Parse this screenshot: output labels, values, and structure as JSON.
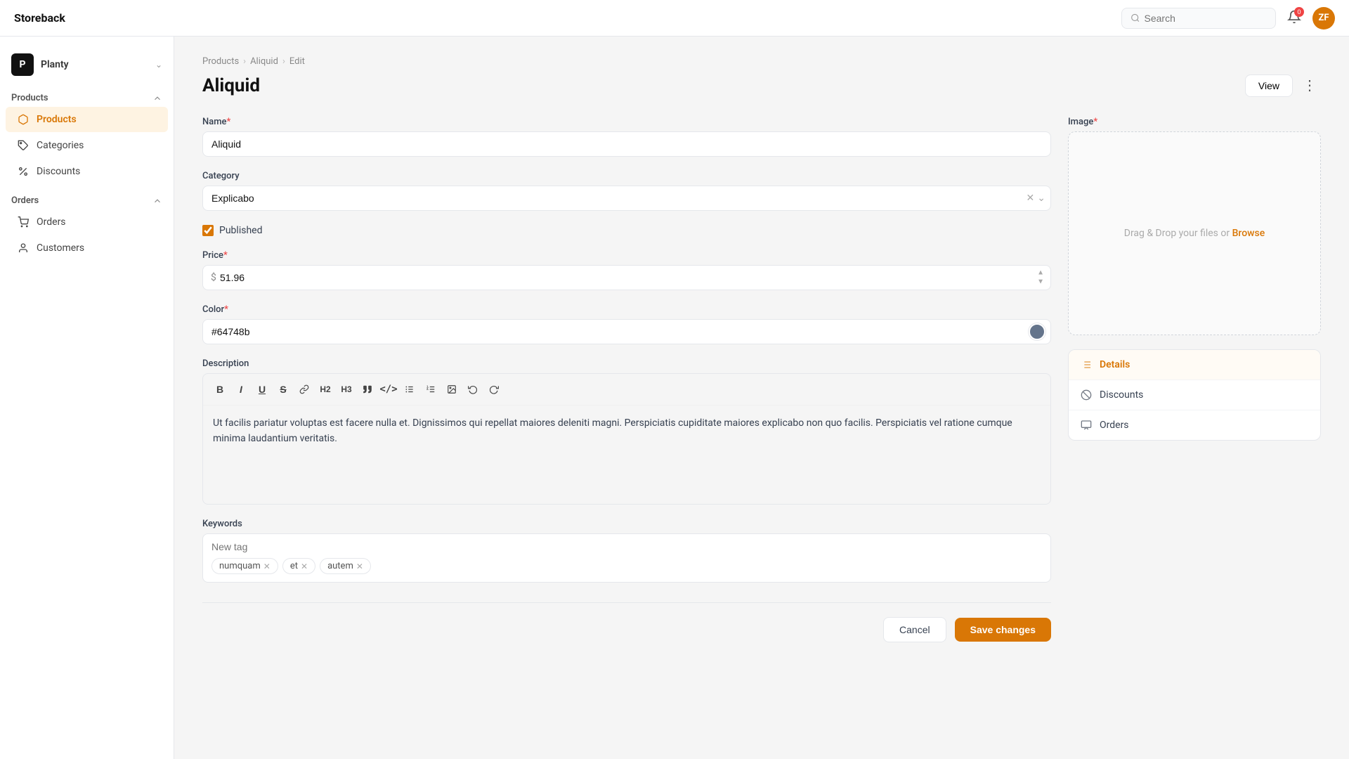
{
  "app": {
    "logo": "Storeback"
  },
  "topnav": {
    "search_placeholder": "Search",
    "notif_count": "0",
    "avatar_initials": "ZF"
  },
  "sidebar": {
    "store_initial": "P",
    "store_name": "Planty",
    "sections": [
      {
        "id": "products",
        "label": "Products",
        "items": [
          {
            "id": "products",
            "label": "Products",
            "active": true,
            "icon": "box"
          },
          {
            "id": "categories",
            "label": "Categories",
            "active": false,
            "icon": "tag"
          },
          {
            "id": "discounts",
            "label": "Discounts",
            "active": false,
            "icon": "percent"
          }
        ]
      },
      {
        "id": "orders",
        "label": "Orders",
        "items": [
          {
            "id": "orders",
            "label": "Orders",
            "active": false,
            "icon": "cart"
          },
          {
            "id": "customers",
            "label": "Customers",
            "active": false,
            "icon": "person"
          }
        ]
      }
    ]
  },
  "breadcrumb": {
    "items": [
      "Products",
      "Aliquid",
      "Edit"
    ]
  },
  "page": {
    "title": "Aliquid",
    "view_btn": "View"
  },
  "form": {
    "name_label": "Name",
    "name_value": "Aliquid",
    "category_label": "Category",
    "category_value": "Explicabo",
    "published_label": "Published",
    "price_label": "Price",
    "price_currency": "$",
    "price_value": "51.96",
    "color_label": "Color",
    "color_value": "#64748b",
    "description_label": "Description",
    "description_text": "Ut facilis pariatur voluptas est facere nulla et. Dignissimos qui repellat maiores deleniti magni. Perspiciatis cupiditate maiores explicabo non quo facilis. Perspiciatis vel ratione cumque minima laudantium veritatis.",
    "image_label": "Image",
    "image_upload_text": "Drag & Drop your files or",
    "image_browse": "Browse",
    "keywords_label": "Keywords",
    "keywords_placeholder": "New tag",
    "tags": [
      "numquam",
      "et",
      "autem"
    ],
    "cancel_btn": "Cancel",
    "save_btn": "Save changes"
  },
  "right_panel": {
    "items": [
      {
        "id": "details",
        "label": "Details",
        "active": true,
        "icon": "list"
      },
      {
        "id": "discounts",
        "label": "Discounts",
        "active": false,
        "icon": "circle-off"
      },
      {
        "id": "orders",
        "label": "Orders",
        "active": false,
        "icon": "cart2"
      }
    ]
  }
}
